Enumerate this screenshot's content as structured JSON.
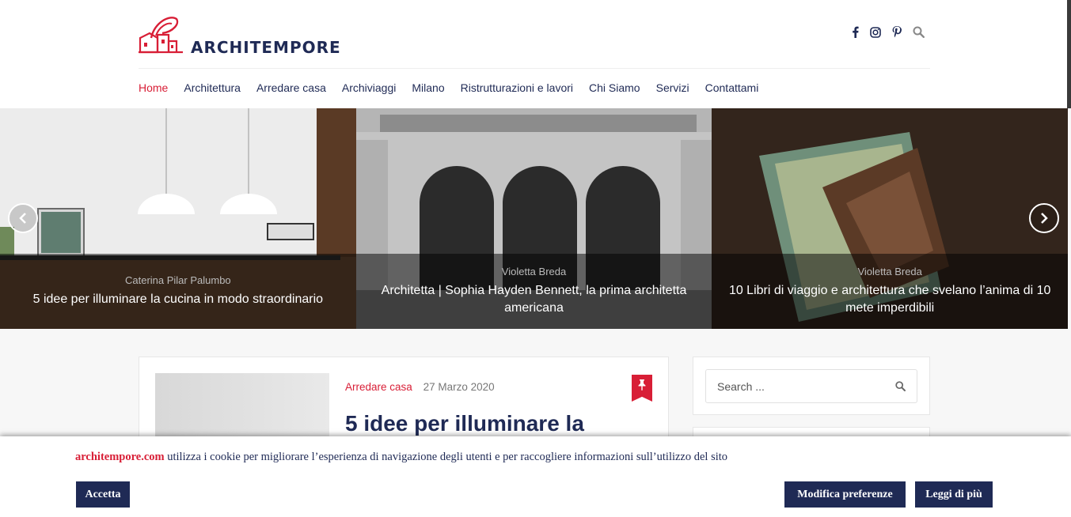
{
  "brand": {
    "name": "ARCHITEMPORE"
  },
  "social": {
    "icons": [
      "facebook-icon",
      "instagram-icon",
      "pinterest-icon",
      "search-icon"
    ]
  },
  "nav": {
    "items": [
      "Home",
      "Architettura",
      "Arredare casa",
      "Archiviaggi",
      "Milano",
      "Ristrutturazioni e lavori",
      "Chi Siamo",
      "Servizi",
      "Contattami"
    ],
    "active": "Home"
  },
  "slider": {
    "slides": [
      {
        "author": "Caterina Pilar Palumbo",
        "title": "5 idee per illuminare la cucina in modo straordinario"
      },
      {
        "author": "Violetta Breda",
        "title": "Architetta | Sophia Hayden Bennett, la prima architetta americana"
      },
      {
        "author": "Violetta Breda",
        "title": "10 Libri di viaggio e architettura che svelano l’anima di 10 mete imperdibili"
      }
    ]
  },
  "post": {
    "category": "Arredare casa",
    "date": "27 Marzo 2020",
    "title": "5 idee per illuminare la"
  },
  "sidebar": {
    "search_placeholder": "Search ..."
  },
  "cookie": {
    "site": "architempore.com",
    "text": " utilizza i cookie per migliorare l’esperienza di navigazione degli utenti e per raccogliere informazioni sull’utilizzo del sito",
    "accept": "Accetta",
    "preferences": "Modifica preferenze",
    "read_more": "Leggi di più"
  },
  "colors": {
    "brand": "#1f2a55",
    "accent": "#d81e36"
  }
}
